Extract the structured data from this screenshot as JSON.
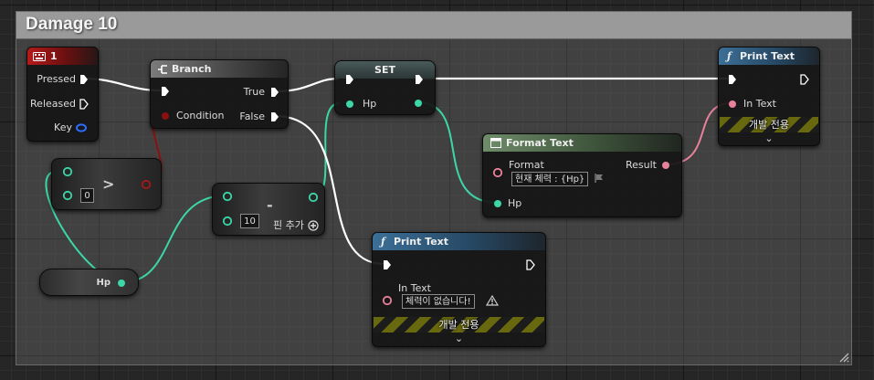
{
  "comment": {
    "title": "Damage 10"
  },
  "colors": {
    "exec": "#ffffff",
    "bool": "#8c1010",
    "int": "#3cd6a8",
    "text": "#e8829b",
    "key": "#2b6fff",
    "event_header": "#b51a1a",
    "function_header": "#3c6f97",
    "dev_stripe": "#68680e"
  },
  "key_event": {
    "title": "1",
    "pins": {
      "pressed": "Pressed",
      "released": "Released",
      "key": "Key"
    }
  },
  "branch": {
    "title": "Branch",
    "pins": {
      "condition": "Condition",
      "true": "True",
      "false": "False"
    }
  },
  "set_node": {
    "title": "SET",
    "pins": {
      "hp": "Hp"
    }
  },
  "greater_node": {
    "operator": ">",
    "b_value": "0"
  },
  "subtract_node": {
    "operator": "-",
    "b_value": "10",
    "add_pin": "핀 추가"
  },
  "hp_getter": {
    "label": "Hp"
  },
  "format_text": {
    "title": "Format Text",
    "pins": {
      "format": "Format",
      "format_value": "현재 체력 : {Hp}",
      "result": "Result",
      "hp": "Hp"
    }
  },
  "print_text_top": {
    "title": "Print Text",
    "pins": {
      "in_text": "In Text"
    },
    "dev_only": "개발 전용"
  },
  "print_text_bottom": {
    "title": "Print Text",
    "pins": {
      "in_text": "In Text",
      "in_text_value": "체력이 없습니다!"
    },
    "dev_only": "개발 전용"
  }
}
